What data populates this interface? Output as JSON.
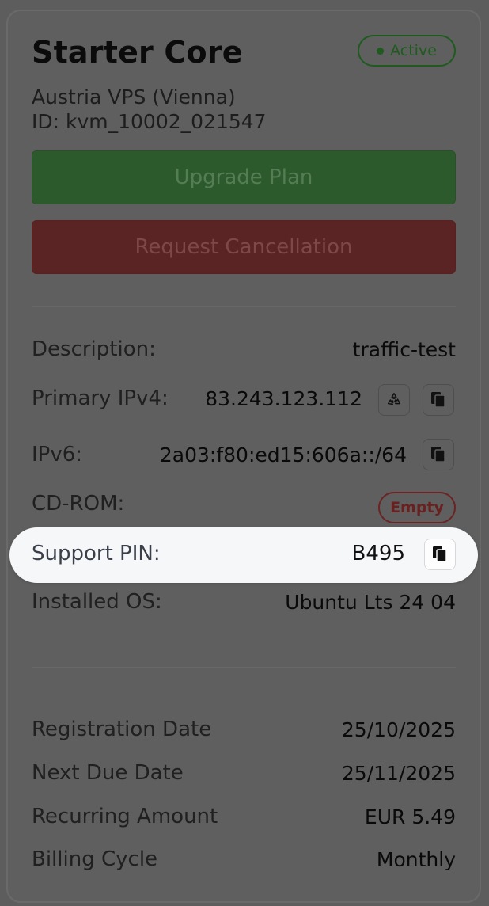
{
  "service": {
    "title": "Starter Core",
    "status": "Active",
    "location": "Austria VPS (Vienna)",
    "id_text": "ID: kvm_10002_021547"
  },
  "actions": {
    "upgrade_label": "Upgrade Plan",
    "cancel_label": "Request Cancellation"
  },
  "details": {
    "description_label": "Description:",
    "description_value": "traffic-test",
    "ipv4_label": "Primary IPv4:",
    "ipv4_value": "83.243.123.112",
    "ipv6_label": "IPv6:",
    "ipv6_value": "2a03:f80:ed15:606a::/64",
    "cdrom_label": "CD-ROM:",
    "cdrom_value": "Empty",
    "pin_label": "Support PIN:",
    "pin_value": "B495",
    "os_label": "Installed OS:",
    "os_value": "Ubuntu Lts 24 04"
  },
  "billing": {
    "registration_label": "Registration Date",
    "registration_value": "25/10/2025",
    "next_due_label": "Next Due Date",
    "next_due_value": "25/11/2025",
    "recurring_label": "Recurring Amount",
    "recurring_value": "EUR 5.49",
    "cycle_label": "Billing Cycle",
    "cycle_value": "Monthly"
  },
  "icons": {
    "copy": "copy-icon",
    "recycle": "recycle-icon",
    "status_dot": "status-dot-icon"
  },
  "colors": {
    "active_green": "#1f5a1f",
    "upgrade_button": "#2d5a2d",
    "cancel_button": "#5a2424",
    "empty_badge": "#6b2424",
    "highlight_bg": "#f6f7f9"
  }
}
